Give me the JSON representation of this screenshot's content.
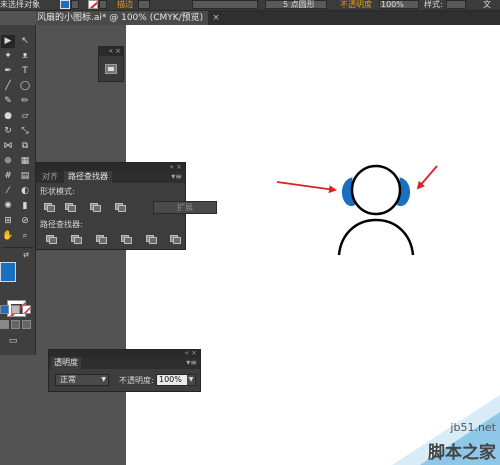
{
  "control_bar": {
    "selection_label": "未选择对象",
    "fill_color": "#1b6fc1",
    "stroke_icon": "no-stroke-icon",
    "stroke_label": "描边",
    "brush_label": "5 点圆形",
    "opacity_label": "不透明度",
    "opacity_value": "100%",
    "style_label": "样式:",
    "doc_label": "文"
  },
  "document": {
    "tab_title": "风扇的小图标.ai* @ 100% (CMYK/预览)"
  },
  "tools": {
    "fill_color": "#1b6fc1",
    "stroke_color": "none"
  },
  "pathfinder_panel": {
    "tab_align": "对齐",
    "tab_pathfinder": "路径查找器",
    "shape_modes_label": "形状模式:",
    "expand_button": "扩展",
    "pathfinders_label": "路径查找器:"
  },
  "transparency_panel": {
    "tab_label": "透明度",
    "blend_mode": "正常",
    "opacity_label": "不透明度:",
    "opacity_value": "100%"
  },
  "artwork": {
    "earmuff_color": "#1b6fc1",
    "line_color": "#000000",
    "arrow_color": "#e02020"
  },
  "watermark": {
    "url": "jb51.net",
    "text": "脚本之家"
  }
}
